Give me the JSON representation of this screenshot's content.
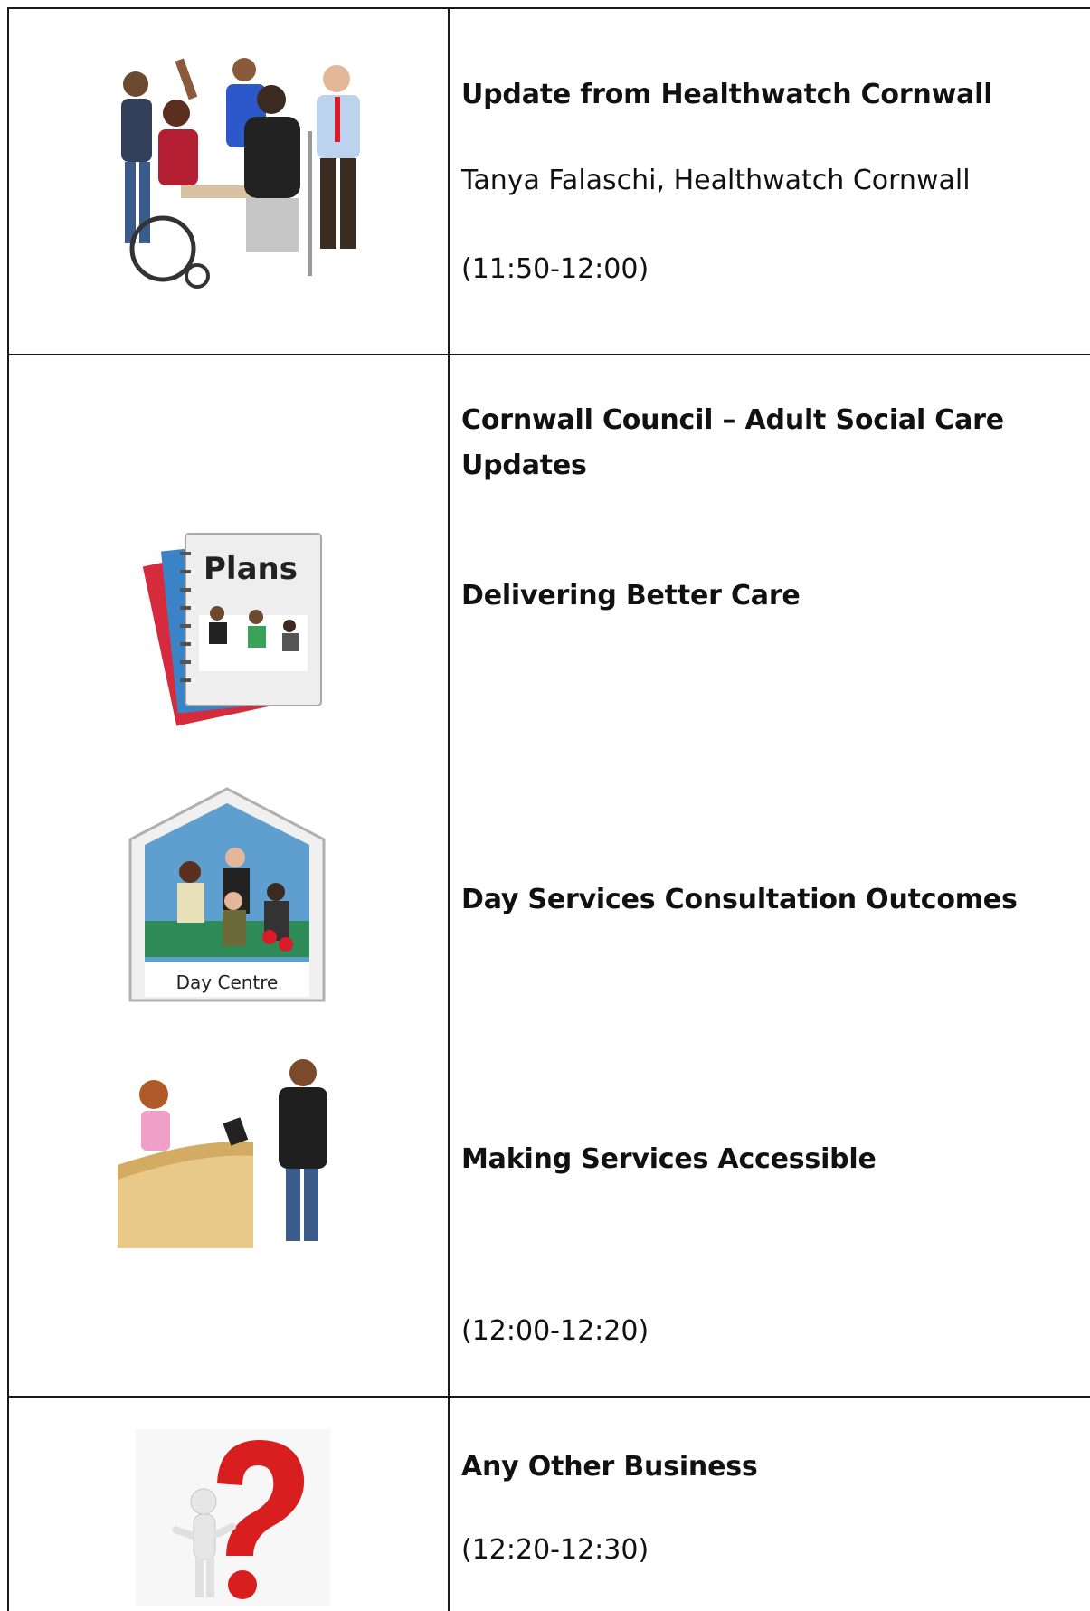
{
  "rows": [
    {
      "title": "Update from Healthwatch Cornwall",
      "speaker": "Tanya Falaschi, Healthwatch Cornwall",
      "time": "(11:50-12:00)",
      "image": "group-of-people-picture"
    },
    {
      "title": "Cornwall Council – Adult Social Care Updates",
      "items": [
        {
          "label": "Delivering Better Care",
          "image": "plans-book-picture",
          "image_text": "Plans"
        },
        {
          "label": "Day Services Consultation Outcomes",
          "image": "day-centre-picture",
          "image_text": "Day Centre"
        },
        {
          "label": "Making Services Accessible",
          "image": "reception-desk-picture"
        }
      ],
      "time": "(12:00-12:20)"
    },
    {
      "title": "Any Other Business",
      "time": "(12:20-12:30)",
      "image": "question-mark-figure-picture"
    }
  ],
  "colors": {
    "border": "#1a1a1a",
    "text": "#111111",
    "question_red": "#d81e1e"
  }
}
